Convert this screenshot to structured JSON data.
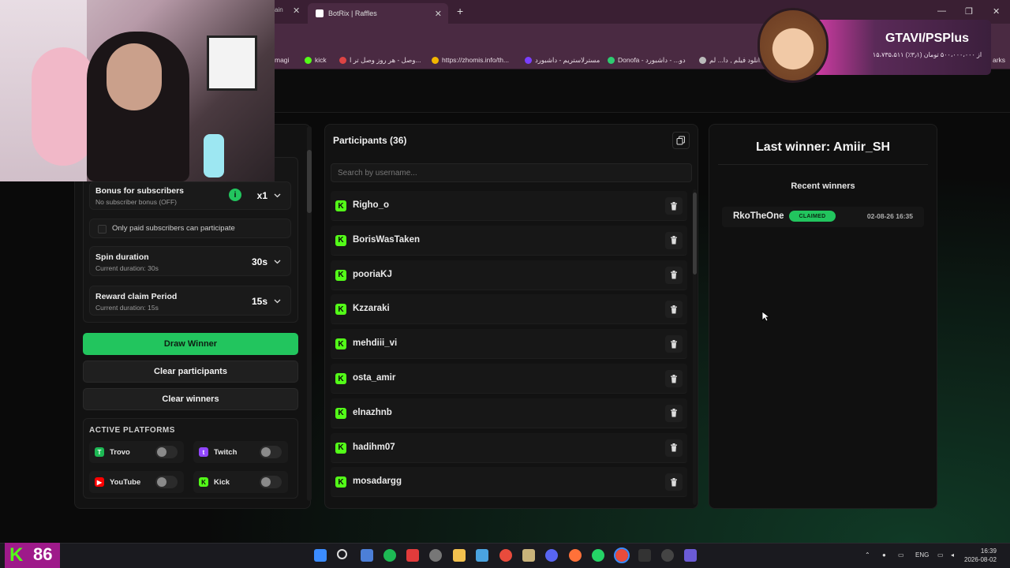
{
  "browser": {
    "tab_stub": "ain",
    "active_tab": "BotRix | Raffles",
    "bookmarks": [
      "magi",
      "kick",
      "وصل - هر روز وصل تر ا...",
      "https://zhomis.info/th...",
      "مسترلاستریم - داشبورد",
      "Donofa - دو... - داشبورد",
      "دانلود فیلم , دا... لم",
      "arks"
    ]
  },
  "promo": {
    "title": "GTAVI/PSPlus",
    "subtitle": "۱۵،۷۳۵،۵۱۱ از ۵۰۰،۰۰۰،۰۰۰ تومان (۳٫۱٪)"
  },
  "settings": {
    "bonus": {
      "title": "Bonus for subscribers",
      "sub": "No subscriber bonus (OFF)",
      "info": "i",
      "value": "x1"
    },
    "paid_only": {
      "label": "Only paid subscribers can participate"
    },
    "spin": {
      "title": "Spin duration",
      "sub": "Current duration: 30s",
      "value": "30s"
    },
    "reward": {
      "title": "Reward claim Period",
      "sub": "Current duration: 15s",
      "value": "15s"
    }
  },
  "buttons": {
    "draw": "Draw Winner",
    "clear_participants": "Clear participants",
    "clear_winners": "Clear winners"
  },
  "platforms": {
    "title": "ACTIVE PLATFORMS",
    "items": [
      {
        "name": "Trovo",
        "color": "#1db954"
      },
      {
        "name": "Twitch",
        "color": "#9146ff"
      },
      {
        "name": "YouTube",
        "color": "#ff0000"
      },
      {
        "name": "Kick",
        "color": "#53fc18"
      }
    ]
  },
  "participants": {
    "title": "Participants (36)",
    "search_placeholder": "Search by username...",
    "list": [
      "Righo_o",
      "BorisWasTaken",
      "pooriaKJ",
      "Kzzaraki",
      "mehdiii_vi",
      "osta_amir",
      "elnazhnb",
      "hadihm07",
      "mosadargg"
    ]
  },
  "winners": {
    "last_winner": "Last winner: Amiir_SH",
    "recent_title": "Recent winners",
    "recent": [
      {
        "name": "RkoTheOne",
        "status": "CLAIMED",
        "date": "02-08-26 16:35"
      }
    ]
  },
  "taskbar": {
    "kick_badge_number": "86",
    "lang": "ENG",
    "time": "16:39",
    "date": "2026-08-02"
  }
}
